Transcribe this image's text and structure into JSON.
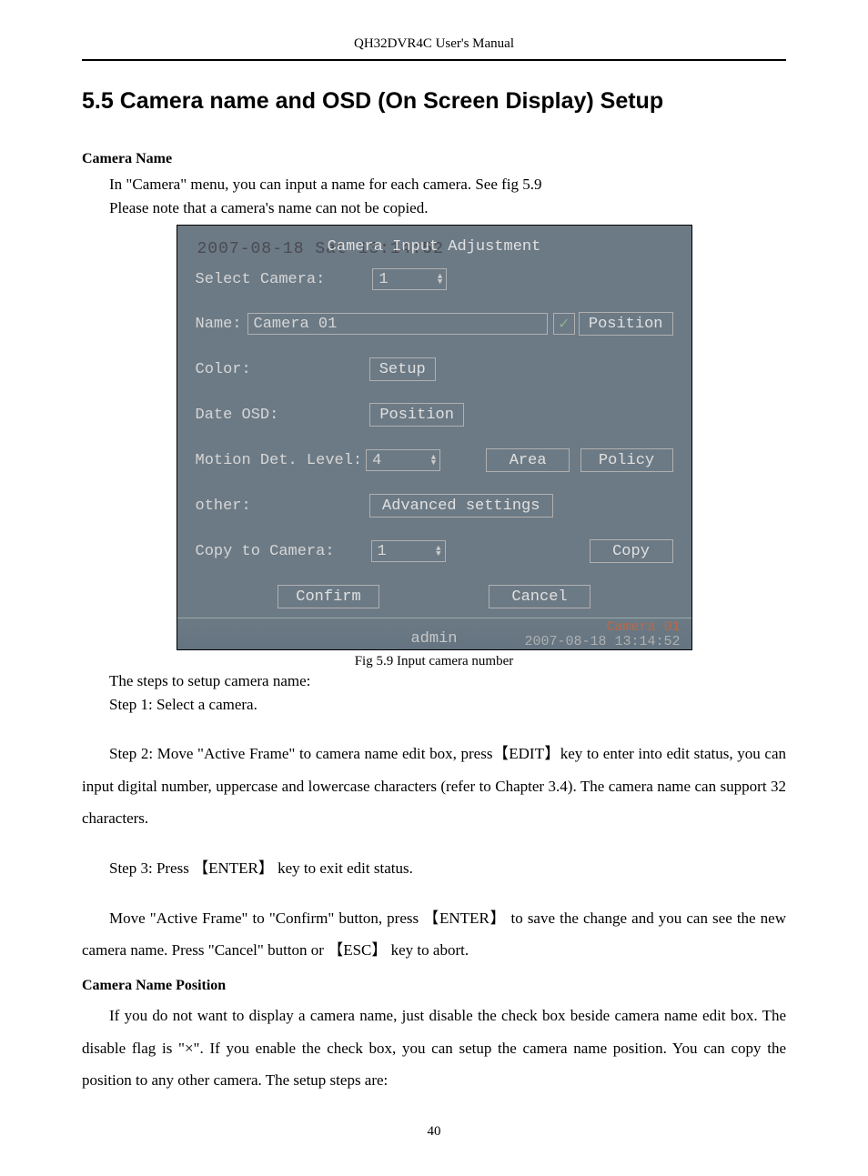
{
  "header": "QH32DVR4C User's Manual",
  "section_title": "5.5 Camera name and OSD (On Screen Display) Setup",
  "sub1": "Camera Name",
  "p1a": "In \"Camera\" menu, you can input a name for each camera. See fig 5.9",
  "p1b": "Please note that a camera's name can not be copied.",
  "fig": {
    "bg_date": "2007-08-18 Sat 13:14:52",
    "title": "Camera Input Adjustment",
    "select_camera_label": "Select Camera:",
    "select_camera_value": "1",
    "name_label": "Name:",
    "name_value": "Camera 01",
    "position_btn": "Position",
    "color_label": "Color:",
    "setup_btn": "Setup",
    "date_osd_label": "Date OSD:",
    "date_osd_btn": "Position",
    "motion_label": "Motion Det. Level:",
    "motion_value": "4",
    "area_btn": "Area",
    "policy_btn": "Policy",
    "other_label": "other:",
    "advanced_btn": "Advanced settings",
    "copy_to_label": "Copy to Camera:",
    "copy_to_value": "1",
    "copy_btn": "Copy",
    "confirm_btn": "Confirm",
    "cancel_btn": "Cancel",
    "status_user": "admin",
    "status_cam": "Camera 01",
    "status_ts": "2007-08-18 13:14:52"
  },
  "caption": "Fig 5.9 Input camera number",
  "p2": "The steps to setup camera name:",
  "p3": "Step 1: Select a camera.",
  "p4": "Step 2: Move \"Active Frame\" to camera name edit box, press【EDIT】key to enter into edit status, you can input digital number, uppercase and lowercase characters (refer to Chapter 3.4). The camera name can support 32 characters.",
  "p5": "Step 3: Press 【ENTER】 key to exit edit status.",
  "p6": "Move \"Active Frame\" to \"Confirm\" button, press 【ENTER】 to save the change and you can see the new camera name. Press \"Cancel\" button or 【ESC】 key to abort.",
  "sub2": "Camera Name Position",
  "p7": "If you do not want to display a camera name, just disable the check box beside camera name edit box. The disable flag is \"×\". If you enable the check box, you can setup the camera name position. You can copy the position to any other camera. The setup steps are:",
  "page_number": "40"
}
